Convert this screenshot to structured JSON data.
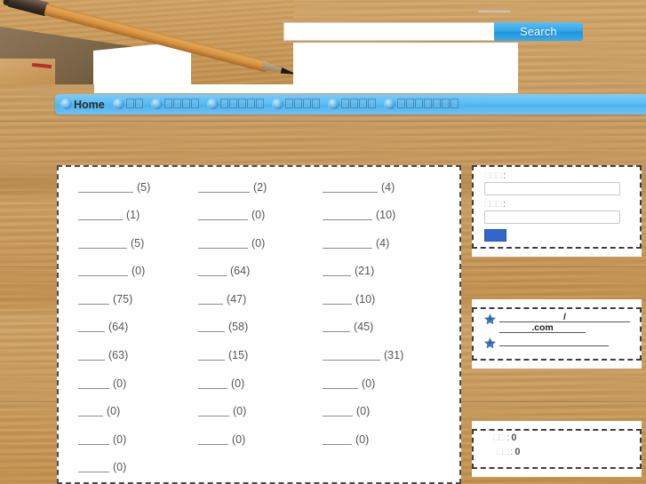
{
  "search": {
    "value": "",
    "placeholder": "",
    "button_label": "Search"
  },
  "nav": {
    "home_label": "Home",
    "items": [
      {
        "label": "Home",
        "glyph_count": 0,
        "missing_glyphs": false
      },
      {
        "label": "",
        "glyph_count": 2,
        "missing_glyphs": true
      },
      {
        "label": "",
        "glyph_count": 4,
        "missing_glyphs": true
      },
      {
        "label": "",
        "glyph_count": 5,
        "missing_glyphs": true
      },
      {
        "label": "",
        "glyph_count": 4,
        "missing_glyphs": true
      },
      {
        "label": "",
        "glyph_count": 4,
        "missing_glyphs": true
      },
      {
        "label": "",
        "glyph_count": 7,
        "missing_glyphs": true
      }
    ],
    "bullet_icon": "blue-sphere-icon"
  },
  "categories": [
    {
      "label": "",
      "count": "(5)",
      "width": 62
    },
    {
      "label": "",
      "count": "(2)",
      "width": 58
    },
    {
      "label": "",
      "count": "(4)",
      "width": 62
    },
    {
      "label": "",
      "count": "(1)",
      "width": 50
    },
    {
      "label": "",
      "count": "(0)",
      "width": 56
    },
    {
      "label": "",
      "count": "(10)",
      "width": 56
    },
    {
      "label": "",
      "count": "(5)",
      "width": 55
    },
    {
      "label": "",
      "count": "(0)",
      "width": 56
    },
    {
      "label": "",
      "count": "(4)",
      "width": 56
    },
    {
      "label": "",
      "count": "(0)",
      "width": 56
    },
    {
      "label": "",
      "count": "(64)",
      "width": 32
    },
    {
      "label": "",
      "count": "(21)",
      "width": 32
    },
    {
      "label": "",
      "count": "(75)",
      "width": 35
    },
    {
      "label": "",
      "count": "(47)",
      "width": 28
    },
    {
      "label": "",
      "count": "(10)",
      "width": 33
    },
    {
      "label": "",
      "count": "(64)",
      "width": 30
    },
    {
      "label": "",
      "count": "(58)",
      "width": 30
    },
    {
      "label": "",
      "count": "(45)",
      "width": 31
    },
    {
      "label": "",
      "count": "(63)",
      "width": 30
    },
    {
      "label": "",
      "count": "(15)",
      "width": 30
    },
    {
      "label": "",
      "count": "(31)",
      "width": 65
    },
    {
      "label": "",
      "count": "(0)",
      "width": 35
    },
    {
      "label": "",
      "count": "(0)",
      "width": 33
    },
    {
      "label": "",
      "count": "(0)",
      "width": 40
    },
    {
      "label": "",
      "count": "(0)",
      "width": 28
    },
    {
      "label": "",
      "count": "(0)",
      "width": 35
    },
    {
      "label": "",
      "count": "(0)",
      "width": 34
    },
    {
      "label": "",
      "count": "(0)",
      "width": 35
    },
    {
      "label": "",
      "count": "(0)",
      "width": 34
    },
    {
      "label": "",
      "count": "(0)",
      "width": 33
    },
    {
      "label": "",
      "count": "(0)",
      "width": 35
    }
  ],
  "login_panel": {
    "field1_label": ":",
    "field1_value": "",
    "field2_label": ":",
    "field2_value": "",
    "submit_label": ""
  },
  "links_panel": {
    "items": [
      {
        "icon": "star-icon",
        "lines": [
          "/",
          ".com"
        ],
        "line_widths": [
          147,
          97
        ]
      },
      {
        "icon": "star-icon",
        "lines": [
          ""
        ],
        "line_widths": [
          123
        ]
      }
    ]
  },
  "stats_panel": {
    "rows": [
      {
        "label": "",
        "sep": ":",
        "value": "0"
      },
      {
        "label": "",
        "sep": ":",
        "value": "0"
      }
    ]
  },
  "colors": {
    "accent_blue": "#2fa5e6",
    "nav_blue": "#5bbcf2",
    "submit_blue": "#3366cc",
    "wood": "#c79a5e",
    "star_blue": "#3a78c2"
  }
}
